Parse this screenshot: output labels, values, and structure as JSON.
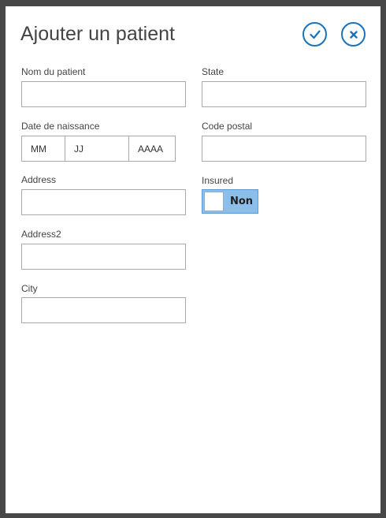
{
  "dialog": {
    "title": "Ajouter un patient",
    "actions": [
      {
        "name": "confirm",
        "icon": "checkmark-icon"
      },
      {
        "name": "close",
        "icon": "close-icon"
      }
    ]
  },
  "form": {
    "patient_name": {
      "label": "Nom du patient",
      "value": ""
    },
    "birth_date": {
      "label": "Date de naissance",
      "month_placeholder": "MM",
      "day_placeholder": "JJ",
      "year_placeholder": "AAAA"
    },
    "address": {
      "label": "Address",
      "value": ""
    },
    "address2": {
      "label": "Address2",
      "value": ""
    },
    "city": {
      "label": "City",
      "value": ""
    },
    "state": {
      "label": "State",
      "value": ""
    },
    "postal_code": {
      "label": "Code postal",
      "value": ""
    },
    "insured": {
      "label": "Insured",
      "state_text": "Non",
      "on": false
    }
  },
  "colors": {
    "accent": "#1a73b8",
    "toggle_fill": "#8cbeea",
    "frame": "#474747"
  }
}
